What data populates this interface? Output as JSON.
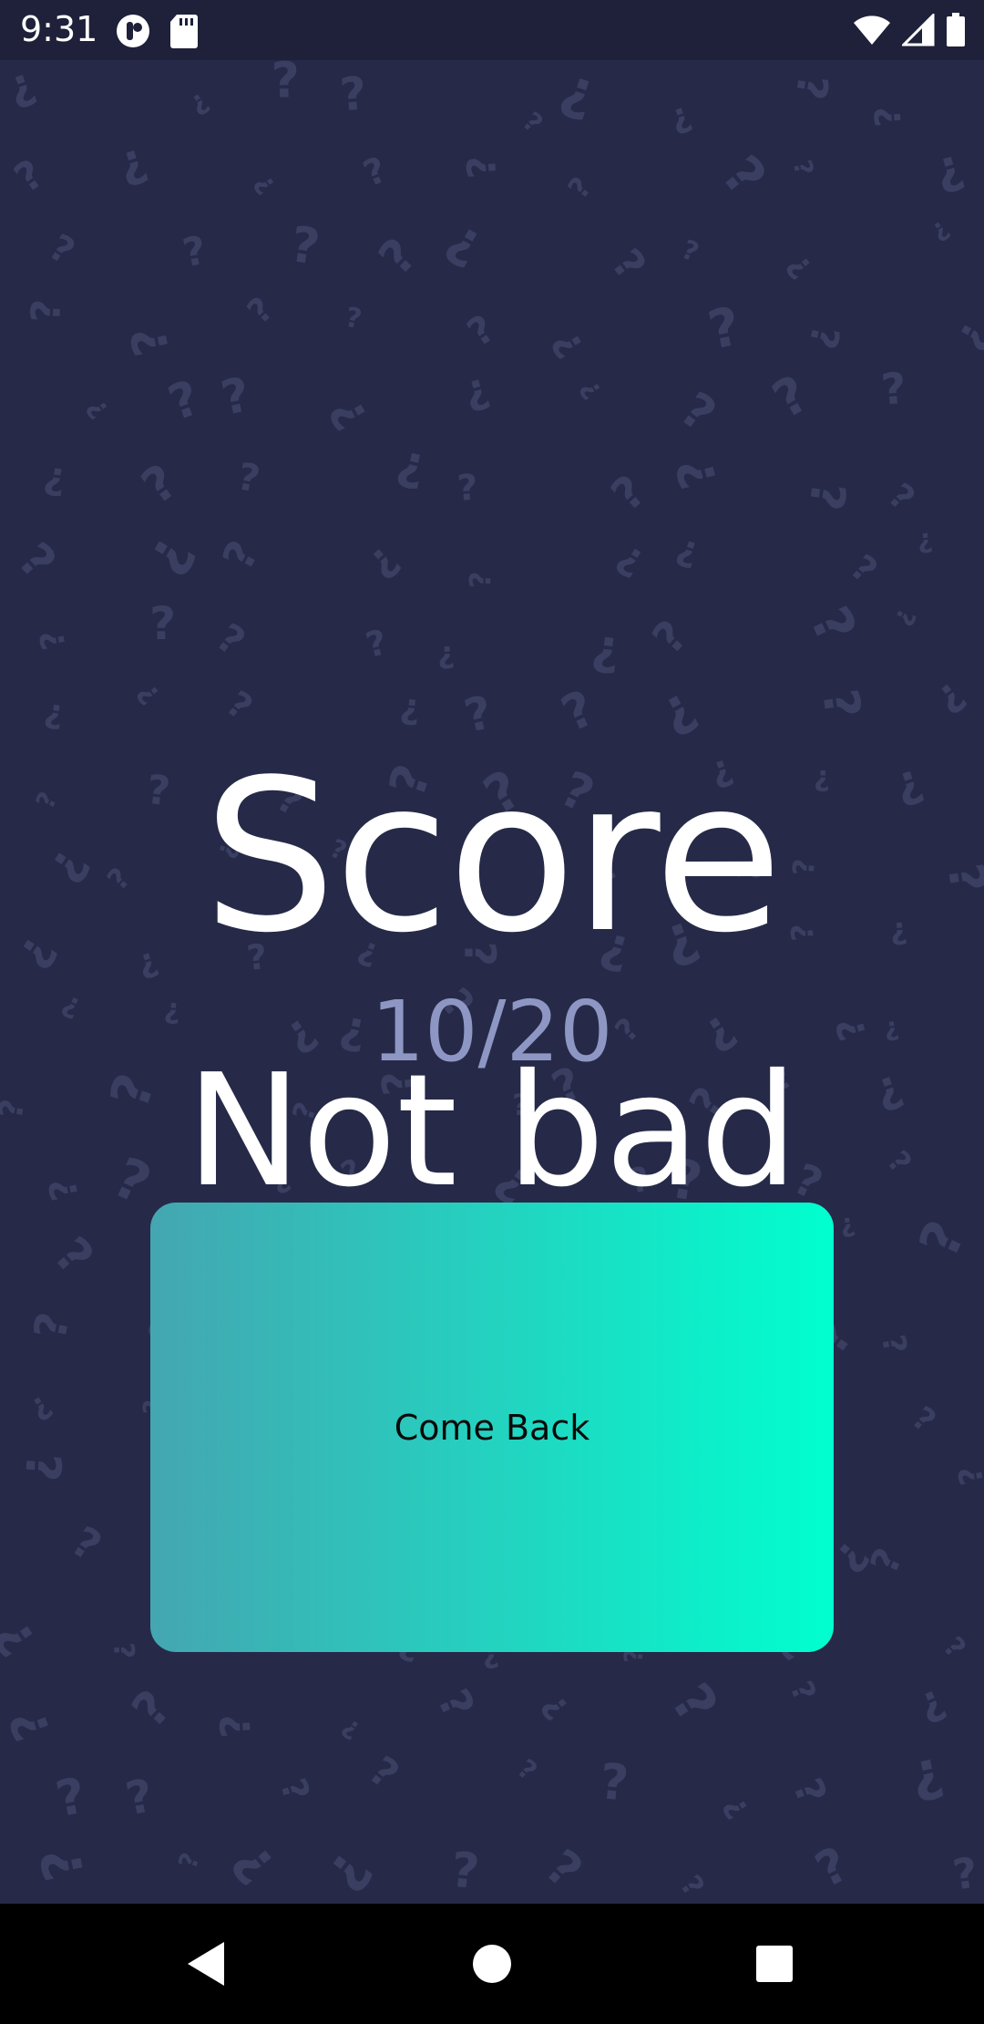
{
  "status_bar": {
    "time": "9:31",
    "left_icons": [
      "notification-app-icon",
      "sd-card-icon"
    ],
    "right_icons": [
      "wifi-icon",
      "signal-icon",
      "battery-icon"
    ]
  },
  "result": {
    "title": "Score",
    "score": "10/20",
    "message": "Not bad"
  },
  "actions": {
    "come_back_label": "Come Back"
  },
  "navigation": {
    "icons": [
      "back-icon",
      "home-icon",
      "recents-icon"
    ]
  },
  "colors": {
    "background": "#262a48",
    "pattern": "#3a3f62",
    "status_bar": "#1e2139",
    "score_value": "#8e97c4",
    "button_gradient_start": "#44a6b1",
    "button_gradient_end": "#00ffcf",
    "nav_bar": "#000000"
  }
}
